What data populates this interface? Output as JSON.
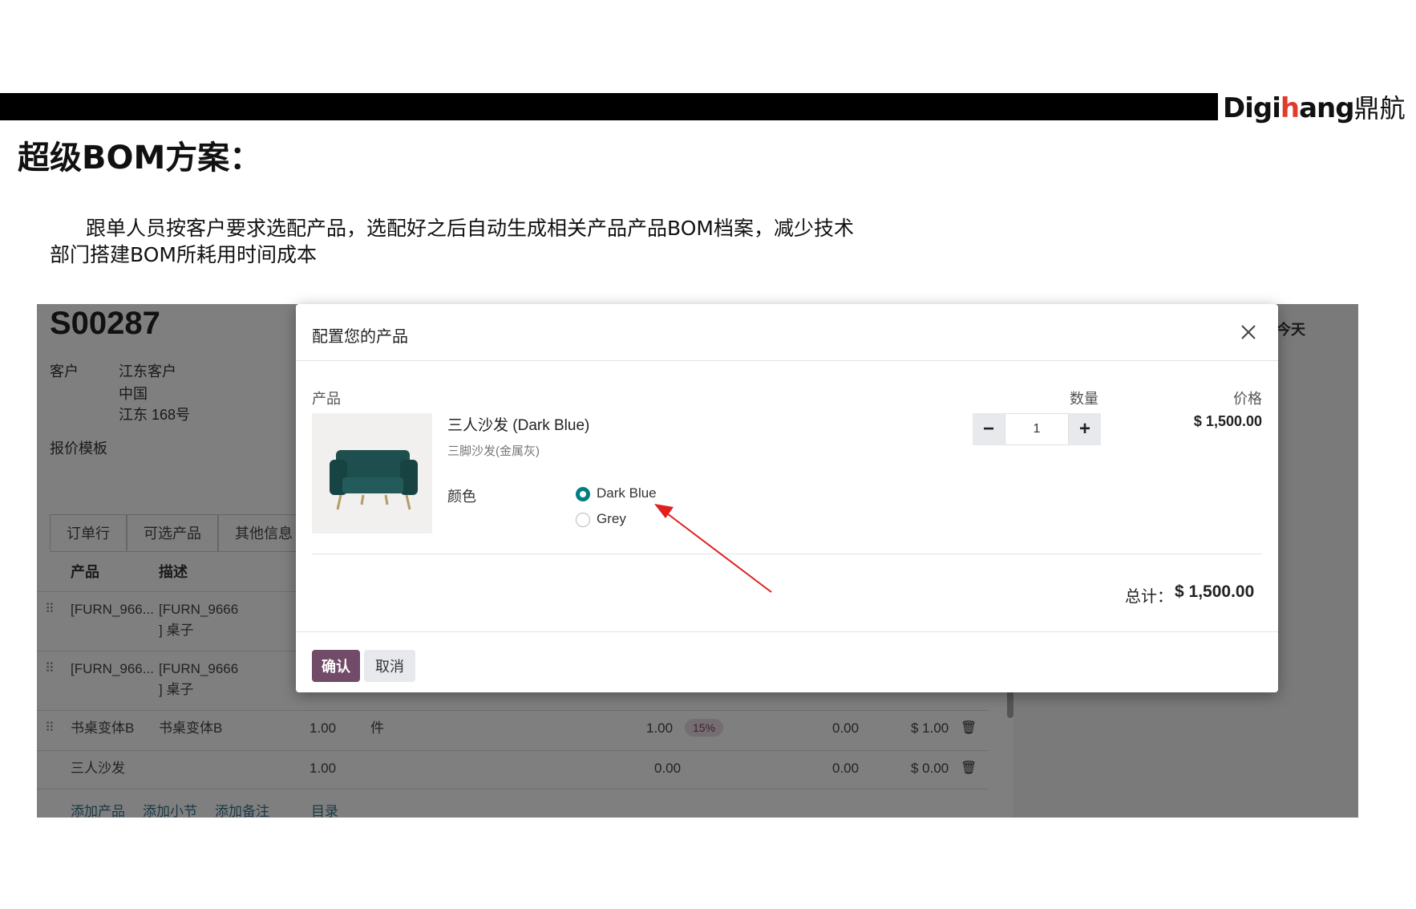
{
  "header": {
    "logo_prefix": "Digi",
    "logo_highlight": "h",
    "logo_suffix": "ang",
    "logo_cn": "鼎航"
  },
  "slide": {
    "title": "超级BOM方案：",
    "desc_line1": "跟单人员按客户要求选配产品，选配好之后自动生成相关产品产品BOM档案，减少技术",
    "desc_line2": "部门搭建BOM所耗用时间成本"
  },
  "order": {
    "number": "S00287",
    "customer_label": "客户",
    "customer_lines": [
      "江东客户",
      "中国",
      "江东 168号"
    ],
    "quote_template_label": "报价模板",
    "today": "今天",
    "tabs": [
      "订单行",
      "可选产品",
      "其他信息"
    ],
    "columns": {
      "product": "产品",
      "description": "描述"
    },
    "rows": [
      {
        "product": "[FURN_966...",
        "desc1": "[FURN_9666",
        "desc2": "] 桌子"
      },
      {
        "product": "[FURN_966...",
        "desc1": "[FURN_9666",
        "desc2": "] 桌子"
      },
      {
        "product": "书桌变体B",
        "desc1": "书桌变体B",
        "qty": "1.00",
        "uom": "件",
        "unit_price": "1.00",
        "discount": "15%",
        "tax": "0.00",
        "subtotal": "$ 1.00"
      },
      {
        "product": "三人沙发",
        "qty": "1.00",
        "unit_price": "0.00",
        "tax": "0.00",
        "subtotal": "$ 0.00"
      }
    ],
    "links": [
      "添加产品",
      "添加小节",
      "添加备注",
      "目录"
    ]
  },
  "modal": {
    "title": "配置您的产品",
    "col_product": "产品",
    "col_qty": "数量",
    "col_price": "价格",
    "product_name": "三人沙发 (Dark Blue)",
    "product_sub": "三脚沙发(金属灰)",
    "attr_label": "颜色",
    "options": [
      {
        "label": "Dark Blue",
        "checked": true
      },
      {
        "label": "Grey",
        "checked": false
      }
    ],
    "quantity": "1",
    "price": "$ 1,500.00",
    "total_label": "总计：",
    "total_value": "$ 1,500.00",
    "confirm": "确认",
    "cancel": "取消",
    "radio_color": "#017e84",
    "confirm_color": "#714b67"
  }
}
